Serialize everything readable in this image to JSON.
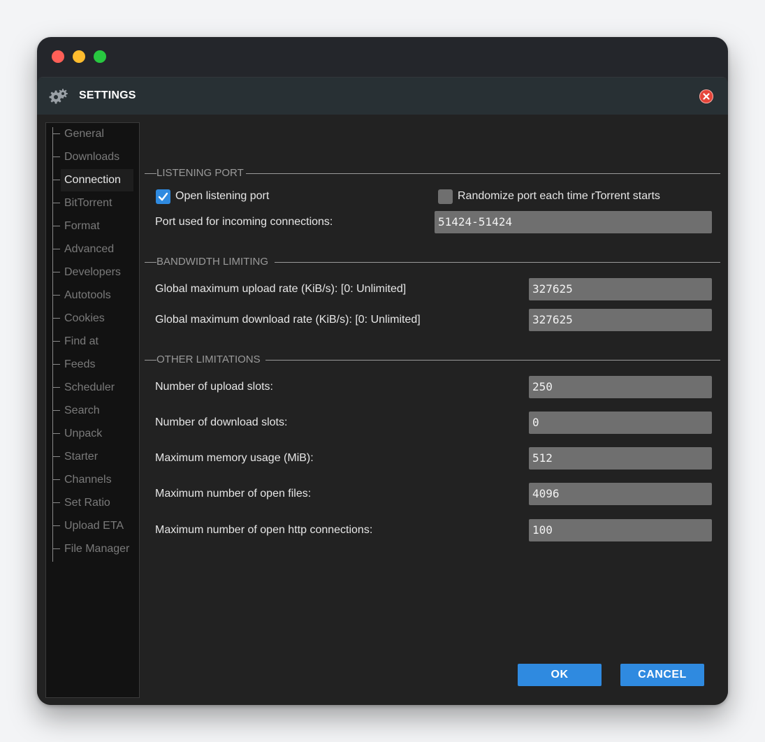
{
  "window": {
    "traffic_colors": [
      "#ff5f57",
      "#febc2e",
      "#28c840"
    ]
  },
  "dialog": {
    "title": "SETTINGS",
    "title_icon": "gears-icon",
    "close_icon": "close-icon"
  },
  "sidebar": {
    "items": [
      {
        "label": "General",
        "active": false
      },
      {
        "label": "Downloads",
        "active": false
      },
      {
        "label": "Connection",
        "active": true
      },
      {
        "label": "BitTorrent",
        "active": false
      },
      {
        "label": "Format",
        "active": false
      },
      {
        "label": "Advanced",
        "active": false
      },
      {
        "label": "Developers",
        "active": false
      },
      {
        "label": "Autotools",
        "active": false
      },
      {
        "label": "Cookies",
        "active": false
      },
      {
        "label": "Find at",
        "active": false
      },
      {
        "label": "Feeds",
        "active": false
      },
      {
        "label": "Scheduler",
        "active": false
      },
      {
        "label": "Search",
        "active": false
      },
      {
        "label": "Unpack",
        "active": false
      },
      {
        "label": "Starter",
        "active": false
      },
      {
        "label": "Channels",
        "active": false
      },
      {
        "label": "Set Ratio",
        "active": false
      },
      {
        "label": "Upload ETA",
        "active": false
      },
      {
        "label": "File Manager",
        "active": false
      }
    ]
  },
  "listening_port": {
    "title": "LISTENING PORT",
    "open_port_label": "Open listening port",
    "open_port_checked": true,
    "randomize_label": "Randomize port each time rTorrent starts",
    "randomize_checked": false,
    "port_label": "Port used for incoming connections:",
    "port_value": "51424-51424"
  },
  "bandwidth": {
    "title": "BANDWIDTH LIMITING",
    "upload_label": "Global maximum upload rate (KiB/s): [0: Unlimited]",
    "upload_value": "327625",
    "download_label": "Global maximum download rate (KiB/s): [0: Unlimited]",
    "download_value": "327625"
  },
  "other": {
    "title": "OTHER LIMITATIONS",
    "upload_slots_label": "Number of upload slots:",
    "upload_slots_value": "250",
    "download_slots_label": "Number of download slots:",
    "download_slots_value": "0",
    "memory_label": "Maximum memory usage (MiB):",
    "memory_value": "512",
    "open_files_label": "Maximum number of open files:",
    "open_files_value": "4096",
    "http_label": "Maximum number of open http connections:",
    "http_value": "100"
  },
  "buttons": {
    "ok": "OK",
    "cancel": "CANCEL"
  },
  "colors": {
    "accent": "#2f8ae0",
    "close": "#e5453a"
  }
}
